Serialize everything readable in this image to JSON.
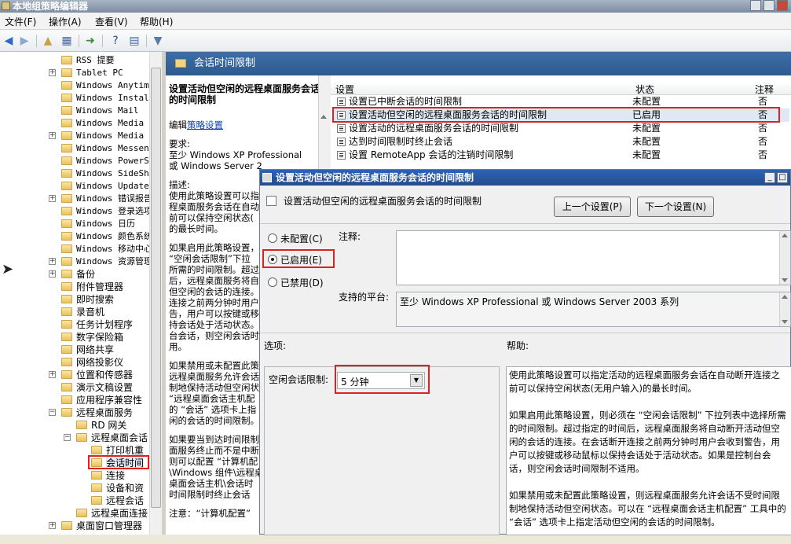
{
  "window": {
    "title": "本地组策略编辑器"
  },
  "menu": [
    "文件(F)",
    "操作(A)",
    "查看(V)",
    "帮助(H)"
  ],
  "tree": {
    "items": [
      {
        "label": "RSS 提要",
        "exp": false,
        "mono": true
      },
      {
        "label": "Tablet PC",
        "exp": true,
        "mono": true
      },
      {
        "label": "Windows Anytime",
        "exp": false,
        "mono": true
      },
      {
        "label": "Windows Install",
        "exp": false,
        "mono": true
      },
      {
        "label": "Windows Mail",
        "exp": false,
        "mono": true
      },
      {
        "label": "Windows Media C",
        "exp": false,
        "mono": true
      },
      {
        "label": "Windows Media P",
        "exp": true,
        "mono": true
      },
      {
        "label": "Windows Messeng",
        "exp": false,
        "mono": true
      },
      {
        "label": "Windows PowerSh",
        "exp": false,
        "mono": true
      },
      {
        "label": "Windows SideSho",
        "exp": false,
        "mono": true
      },
      {
        "label": "Windows Update",
        "exp": false,
        "mono": true
      },
      {
        "label": "Windows 错误报告",
        "exp": true,
        "mono": true
      },
      {
        "label": "Windows 登录选项",
        "exp": false,
        "mono": true
      },
      {
        "label": "Windows 日历",
        "exp": false,
        "mono": true
      },
      {
        "label": "Windows 颜色系统",
        "exp": false,
        "mono": true
      },
      {
        "label": "Windows 移动中心",
        "exp": false,
        "mono": true
      },
      {
        "label": "Windows 资源管理",
        "exp": true,
        "mono": true
      },
      {
        "label": "备份",
        "exp": true,
        "mono": false
      },
      {
        "label": "附件管理器",
        "exp": false,
        "mono": false
      },
      {
        "label": "即时搜索",
        "exp": false,
        "mono": false
      },
      {
        "label": "录音机",
        "exp": false,
        "mono": false
      },
      {
        "label": "任务计划程序",
        "exp": false,
        "mono": false
      },
      {
        "label": "数字保险箱",
        "exp": false,
        "mono": false
      },
      {
        "label": "网络共享",
        "exp": false,
        "mono": false
      },
      {
        "label": "网络投影仪",
        "exp": false,
        "mono": false
      },
      {
        "label": "位置和传感器",
        "exp": true,
        "mono": false
      },
      {
        "label": "演示文稿设置",
        "exp": false,
        "mono": false
      },
      {
        "label": "应用程序兼容性",
        "exp": false,
        "mono": false
      },
      {
        "label": "远程桌面服务",
        "exp": true,
        "expanded": true,
        "mono": false
      },
      {
        "label": "RD 网关",
        "exp": false,
        "mono": false,
        "indent": 1
      },
      {
        "label": "远程桌面会话",
        "exp": true,
        "expanded": true,
        "mono": false,
        "indent": 1
      },
      {
        "label": "打印机重",
        "exp": false,
        "mono": false,
        "indent": 2
      },
      {
        "label": "会话时间",
        "exp": false,
        "mono": false,
        "indent": 2,
        "selected": true
      },
      {
        "label": "连接",
        "exp": false,
        "mono": false,
        "indent": 2
      },
      {
        "label": "设备和资",
        "exp": false,
        "mono": false,
        "indent": 2
      },
      {
        "label": "远程会话",
        "exp": false,
        "mono": false,
        "indent": 2
      },
      {
        "label": "远程桌面连接",
        "exp": false,
        "mono": false,
        "indent": 1
      },
      {
        "label": "桌面窗口管理器",
        "exp": true,
        "mono": false
      }
    ]
  },
  "right_header": {
    "title": "会话时间限制"
  },
  "desc": {
    "title": "设置活动但空闲的远程桌面服务会话的时间限制",
    "edit_prefix": "编辑",
    "edit_link": "策略设置",
    "req": "要求:\n至少 Windows XP Professional\n或 Windows Server 2",
    "desc": "描述:\n使用此策略设置可以指\n程桌面服务会话在自动\n前可以保持空闲状态(\n的最长时间。",
    "p_enabled": "如果启用此策略设置，\n“空闲会话限制”下拉\n所需的时间限制。超过\n后，远程桌面服务将自\n但空闲的会话的连接。\n连接之前两分钟时用户\n告，用户可以按键或移\n持会话处于活动状态。\n台会话，则空闲会话时\n用。",
    "p_disabled": "如果禁用或未配置此策\n远程桌面服务允许会话\n制地保持活动但空闲状\n“远程桌面会话主机配\n的 “会话” 选项卡上指\n闲的会话的时间限制。",
    "p_reached": "如果要当到达时间限制时\n面服务终止而不是中断\n则可以配置 “计算机配\n\\Windows 组件\\远程桌\n桌面会话主机\\会话时\n时间限制时终止会话",
    "note": "注意：“计算机配置”"
  },
  "list": {
    "headers": {
      "setting": "设置",
      "state": "状态",
      "comment": "注释"
    },
    "rows": [
      {
        "name": "设置已中断会话的时间限制",
        "state": "未配置",
        "comment": "否"
      },
      {
        "name": "设置活动但空闲的远程桌面服务会话的时间限制",
        "state": "已启用",
        "comment": "否"
      },
      {
        "name": "设置活动的远程桌面服务会话的时间限制",
        "state": "未配置",
        "comment": "否"
      },
      {
        "name": "达到时间限制时终止会话",
        "state": "未配置",
        "comment": "否"
      },
      {
        "name": "设置 RemoteApp 会话的注销时间限制",
        "state": "未配置",
        "comment": "否"
      }
    ]
  },
  "dialog": {
    "title": "设置活动但空闲的远程桌面服务会话的时间限制",
    "setting_name": "设置活动但空闲的远程桌面服务会话的时间限制",
    "prev_button": "上一个设置(P)",
    "next_button": "下一个设置(N)",
    "radio_not_configured": "未配置(C)",
    "radio_enabled": "已启用(E)",
    "radio_disabled": "已禁用(D)",
    "comment_label": "注释:",
    "platform_label": "支持的平台:",
    "platform_value": "至少 Windows XP Professional 或 Windows Server 2003 系列",
    "options_label": "选项:",
    "help_label": "帮助:",
    "idle_limit_label": "空闲会话限制:",
    "idle_limit_value": "5 分钟",
    "help_p1": "使用此策略设置可以指定活动的远程桌面服务会话在自动断开连接之前可以保持空闲状态(无用户输入)的最长时间。",
    "help_p2": "如果启用此策略设置，则必须在 “空闲会话限制” 下拉列表中选择所需的时间限制。超过指定的时间后，远程桌面服务将自动断开活动但空闲的会话的连接。在会话断开连接之前两分钟时用户会收到警告，用户可以按键或移动鼠标以保持会话处于活动状态。如果是控制台会话，则空闲会话时间限制不适用。",
    "help_p3": "如果禁用或未配置此策略设置，则远程桌面服务允许会话不受时间限制地保持活动但空闲状态。可以在 “远程桌面会话主机配置” 工具中的 “会话” 选项卡上指定活动但空闲的会话的时间限制。"
  },
  "colors": {
    "accent": "#2e5a8e",
    "highlight": "#e02020"
  }
}
